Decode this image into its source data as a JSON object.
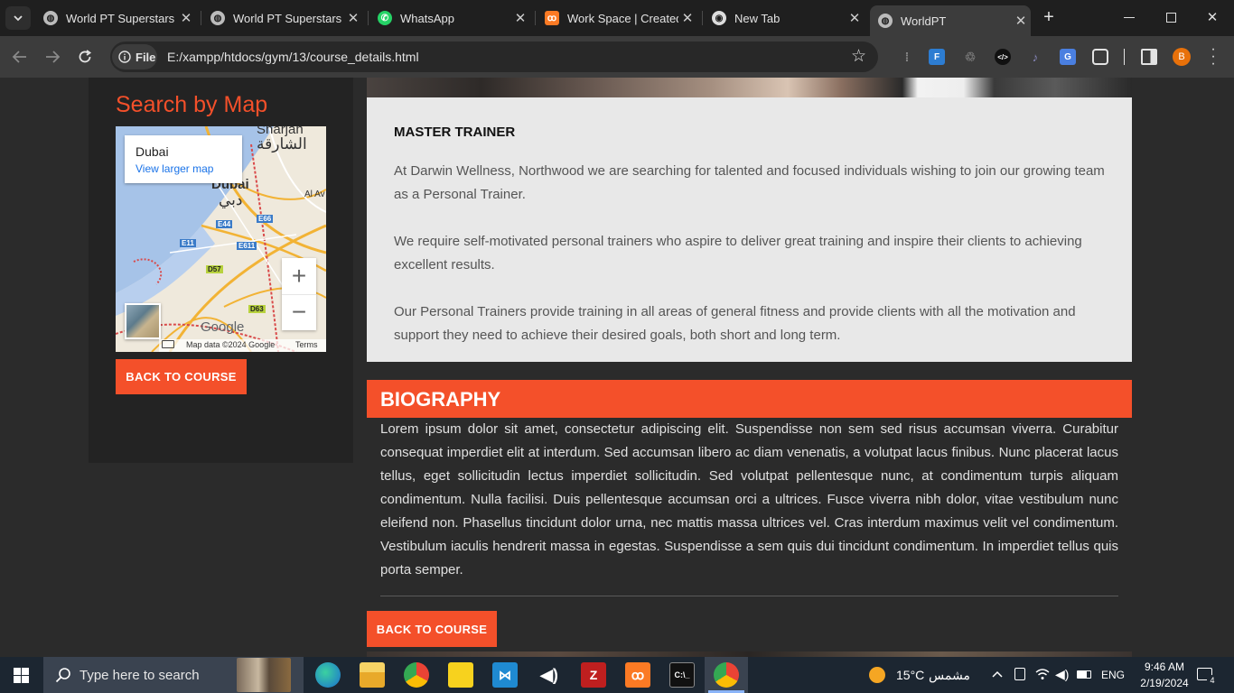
{
  "browser": {
    "tabs": [
      {
        "title": "World PT Superstars"
      },
      {
        "title": "World PT Superstars"
      },
      {
        "title": "WhatsApp"
      },
      {
        "title": "Work Space | Created"
      },
      {
        "title": "New Tab"
      },
      {
        "title": "WorldPT"
      }
    ],
    "new_tab_symbol": "+",
    "close_symbol": "✕",
    "address": {
      "scheme_label": "File",
      "url": "E:/xampp/htdocs/gym/13/course_details.html"
    },
    "profile_initial": "B"
  },
  "sidebar": {
    "map_heading": "Search by Map",
    "map": {
      "place_name": "Dubai",
      "larger_map_link": "View larger map",
      "zoom_in": "+",
      "zoom_out": "−",
      "attribution": "Map data ©2024 Google",
      "terms": "Terms",
      "logo": "Google",
      "labels": {
        "sharjah_en": "Sharjah",
        "sharjah_ar": "الشارقة",
        "dubai_en": "Dubai",
        "dubai_ar": "دبي",
        "al_aweer": "Al Av",
        "e44": "E44",
        "e66": "E66",
        "e11": "E11",
        "e611": "E611",
        "d57": "D57",
        "d63": "D63"
      }
    },
    "back_button": "BACK TO COURSE"
  },
  "trainer": {
    "heading": "MASTER TRAINER",
    "paragraphs": [
      "At Darwin Wellness, Northwood we are searching for talented and focused individuals wishing to join our growing team as a Personal Trainer.",
      "We require self-motivated personal trainers who aspire to deliver great training and inspire their clients to achieving excellent results.",
      "Our Personal Trainers provide training in all areas of general fitness and provide clients with all the motivation and support they need to achieve their desired goals, both short and long term."
    ]
  },
  "biography": {
    "heading": "BIOGRAPHY",
    "text": "Lorem ipsum dolor sit amet, consectetur adipiscing elit. Suspendisse non sem sed risus accumsan viverra. Curabitur consequat imperdiet elit at interdum. Sed accumsan libero ac diam venenatis, a volutpat lacus finibus. Nunc placerat lacus tellus, eget sollicitudin lectus imperdiet sollicitudin. Sed volutpat pellentesque nunc, at condimentum turpis aliquam condimentum. Nulla facilisi. Duis pellentesque accumsan orci a ultrices. Fusce viverra nibh dolor, vitae vestibulum nunc eleifend non. Phasellus tincidunt dolor urna, nec mattis massa ultrices vel. Cras interdum maximus velit vel condimentum. Vestibulum iaculis hendrerit massa in egestas. Suspendisse a sem quis dui tincidunt condimentum. In imperdiet tellus quis porta semper.",
    "back_button": "BACK TO COURSE"
  },
  "taskbar": {
    "search_placeholder": "Type here to search",
    "weather_temp": "15°C",
    "weather_desc": "مشمس",
    "language": "ENG",
    "time": "9:46 AM",
    "date": "2/19/2024",
    "notification_count": "4"
  },
  "colors": {
    "accent": "#f4502a",
    "page_bg": "#2b2b2b",
    "card_bg": "#e8e8e8"
  }
}
